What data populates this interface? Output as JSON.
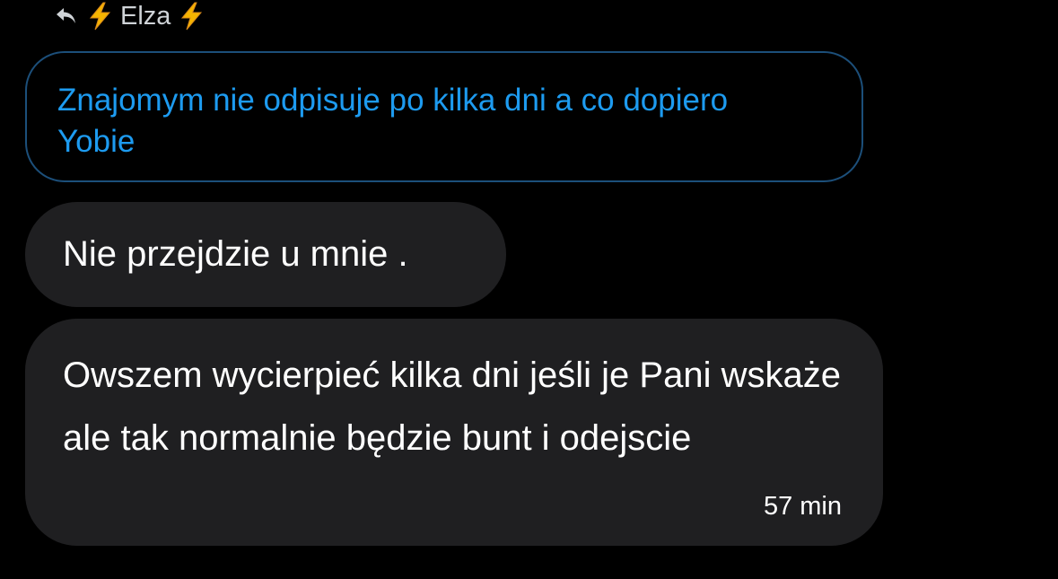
{
  "reply_header": {
    "icon": "reply-arrow-icon",
    "name": "Elza",
    "emoji": "lightning-bolt-icon"
  },
  "quoted_message": {
    "text": "Znajomym nie odpisuje po kilka dni a co dopiero Yobie",
    "color": "#1d9bf0",
    "border_color": "#1c4f7a"
  },
  "messages": [
    {
      "text": "Nie przejdzie u mnie ."
    },
    {
      "text": "Owszem wycierpieć kilka dni jeśli je Pani wskaże ale tak normalnie będzie bunt i odejscie",
      "time": "57 min"
    }
  ],
  "colors": {
    "background": "#000000",
    "bubble": "#1f1f21",
    "bolt": "#f5b400"
  }
}
